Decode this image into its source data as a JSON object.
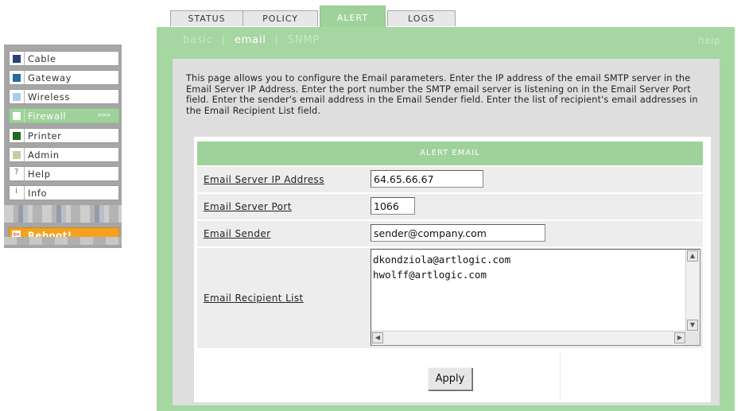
{
  "nav": {
    "items": [
      {
        "label": "Cable",
        "color": "#2b3f7a"
      },
      {
        "label": "Gateway",
        "color": "#1f6f9e"
      },
      {
        "label": "Wireless",
        "color": "#a9cdec"
      },
      {
        "label": "Firewall",
        "color": "#ffffff",
        "arrow": ">>>"
      },
      {
        "label": "Printer",
        "color": "#1e6b1e"
      },
      {
        "label": "Admin",
        "color": "#c4cfa0"
      },
      {
        "label": "Help",
        "glyph": "?"
      },
      {
        "label": "Info",
        "glyph": "i"
      }
    ],
    "reboot_label": "Reboot!"
  },
  "tabs": [
    "STATUS",
    "POLICY",
    "ALERT",
    "LOGS"
  ],
  "active_tab": "ALERT",
  "subnav": {
    "items": [
      "basic",
      "email",
      "SNMP"
    ],
    "active": "email",
    "separator": "|",
    "help": "help"
  },
  "intro_text": "This page allows you to configure the Email parameters. Enter the IP address of the email SMTP server in the Email Server IP Address. Enter the port number the SMTP email server is listening on in the Email Server Port field. Enter the sender's email address in the Email Sender field. Enter the list of recipient's email addresses in the Email Recipient List field.",
  "form": {
    "header": "ALERT EMAIL",
    "server_ip": {
      "label": "Email Server IP Address",
      "value": "64.65.66.67"
    },
    "server_port": {
      "label": "Email Server Port",
      "value": "1066"
    },
    "sender": {
      "label": "Email Sender",
      "value": "sender@company.com"
    },
    "recipients": {
      "label": "Email Recipient List",
      "value": "dkondziola@artlogic.com\nhwolff@artlogic.com"
    },
    "apply_label": "Apply"
  },
  "colors": {
    "accent_green": "#9fd29b",
    "panel_green": "#a6d6a2",
    "reboot_orange": "#f4a21e"
  }
}
